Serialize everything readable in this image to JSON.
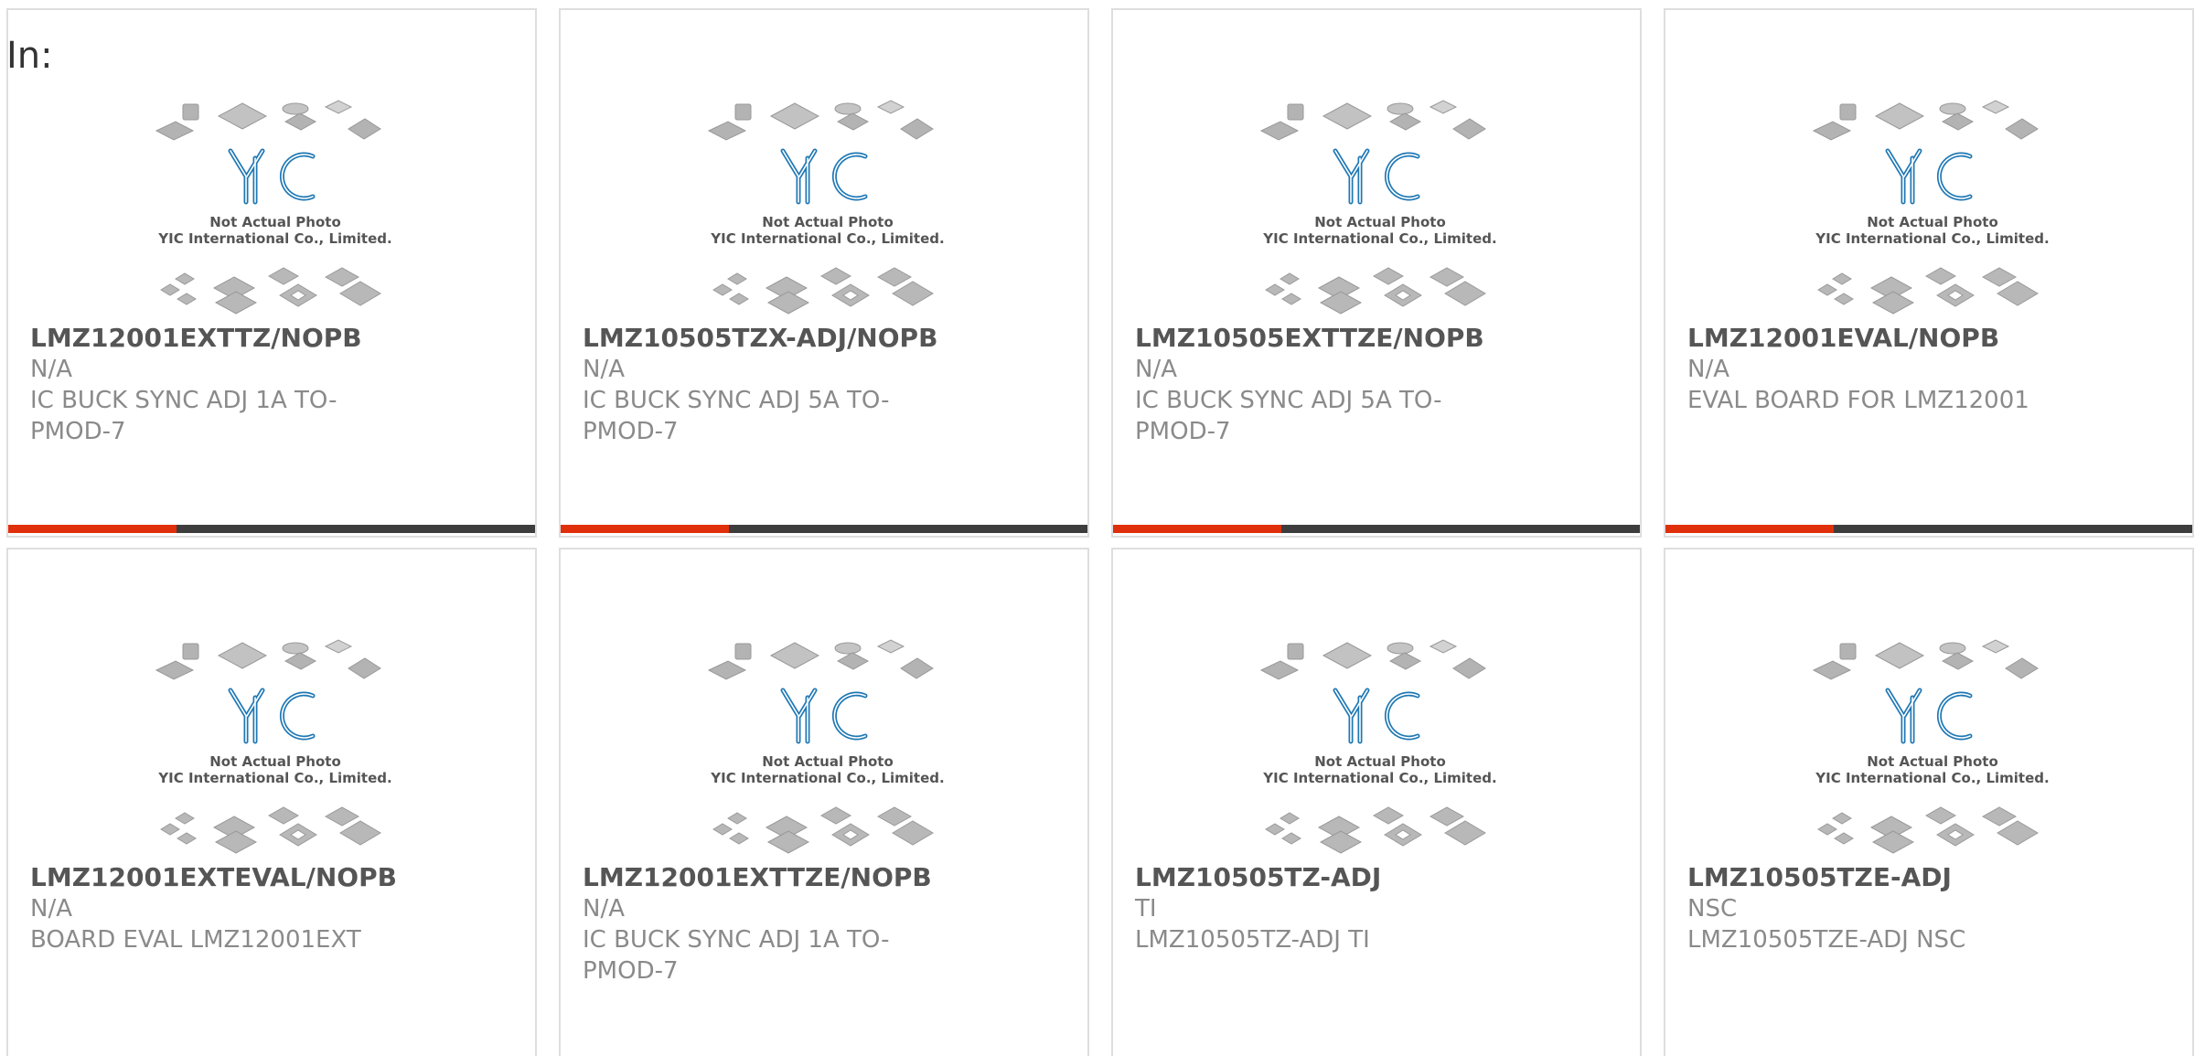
{
  "header": {
    "label": "In:"
  },
  "photo": {
    "brand": "YIC",
    "line1": "Not Actual Photo",
    "line2": "YIC International Co., Limited."
  },
  "colors": {
    "accent": "#e0300b",
    "track": "#3d3d3d",
    "logo": "#1f78b4"
  },
  "products": [
    {
      "part": "LMZ12001EXTTZ/NOPB",
      "mfr": "N/A",
      "desc": "IC BUCK SYNC ADJ 1A TO-PMOD-7",
      "progress": 0.32
    },
    {
      "part": "LMZ10505TZX-ADJ/NOPB",
      "mfr": "N/A",
      "desc": "IC BUCK SYNC ADJ 5A TO-PMOD-7",
      "progress": 0.32
    },
    {
      "part": "LMZ10505EXTTZE/NOPB",
      "mfr": "N/A",
      "desc": "IC BUCK SYNC ADJ 5A TO-PMOD-7",
      "progress": 0.32
    },
    {
      "part": "LMZ12001EVAL/NOPB",
      "mfr": "N/A",
      "desc": "EVAL BOARD FOR LMZ12001",
      "progress": 0.32
    },
    {
      "part": "LMZ12001EXTEVAL/NOPB",
      "mfr": "N/A",
      "desc": "BOARD EVAL LMZ12001EXT",
      "progress": null
    },
    {
      "part": "LMZ12001EXTTZE/NOPB",
      "mfr": "N/A",
      "desc": "IC BUCK SYNC ADJ 1A TO-PMOD-7",
      "progress": null
    },
    {
      "part": "LMZ10505TZ-ADJ",
      "mfr": "TI",
      "desc": "LMZ10505TZ-ADJ TI",
      "progress": null
    },
    {
      "part": "LMZ10505TZE-ADJ",
      "mfr": "NSC",
      "desc": "LMZ10505TZE-ADJ NSC",
      "progress": null
    }
  ]
}
